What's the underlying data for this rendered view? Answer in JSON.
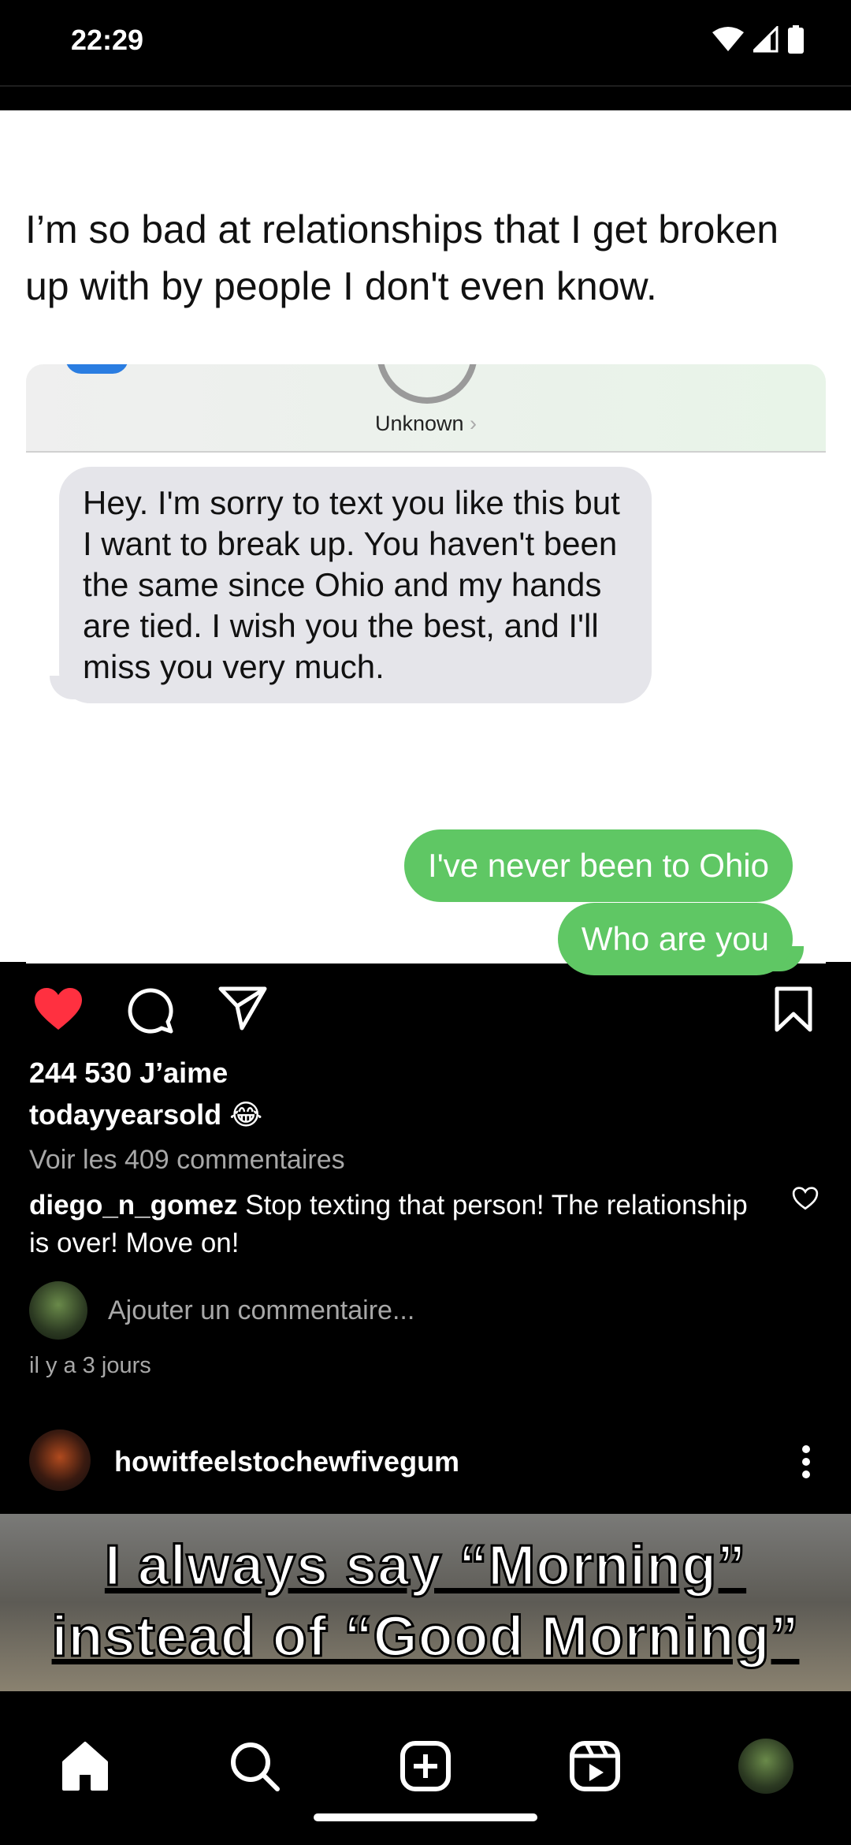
{
  "status_bar": {
    "time": "22:29"
  },
  "post": {
    "tweet_text": "I’m so bad at relationships that I get broken up with by people I don't even know.",
    "sms": {
      "contact": "Unknown",
      "received": "Hey. I'm sorry to text you like this but I want to break up. You haven't been the same since Ohio and my hands are tied. I wish you the best, and I'll miss you very much.",
      "sent": [
        "I've never been to Ohio",
        "Who are you"
      ]
    },
    "likes": "244 530 J’aime",
    "caption_user": "todayyearsold",
    "caption_emoji": "😂",
    "view_comments": "Voir les 409 commentaires",
    "comment_user": "diego_n_gomez",
    "comment_text": "Stop texting that person! The relationship is over! Move on!",
    "add_comment_placeholder": "Ajouter un commentaire...",
    "timestamp": "il y a 3 jours",
    "liked": true
  },
  "next_post": {
    "username": "howitfeelstochewfivegum",
    "meme_line1": "I always say “Morning”",
    "meme_line2": "instead of “Good Morning”"
  },
  "nav": {
    "items": [
      "home-icon",
      "search-icon",
      "create-icon",
      "reels-icon",
      "profile-avatar"
    ],
    "active": "home-icon"
  },
  "colors": {
    "like_red": "#ff3040",
    "sms_green": "#5fc764",
    "sms_gray": "#e5e5ea"
  }
}
